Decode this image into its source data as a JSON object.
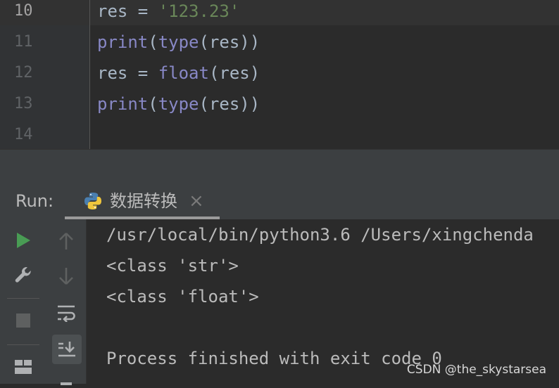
{
  "editor": {
    "lines": [
      {
        "number": "10",
        "tokens": [
          {
            "t": "res = ",
            "c": "plain"
          },
          {
            "t": "'123.23'",
            "c": "str"
          }
        ]
      },
      {
        "number": "11",
        "tokens": [
          {
            "t": "print",
            "c": "builtin"
          },
          {
            "t": "(",
            "c": "plain"
          },
          {
            "t": "type",
            "c": "builtin"
          },
          {
            "t": "(res))",
            "c": "plain"
          }
        ]
      },
      {
        "number": "12",
        "tokens": [
          {
            "t": "res = ",
            "c": "plain"
          },
          {
            "t": "float",
            "c": "builtin"
          },
          {
            "t": "(res)",
            "c": "plain"
          }
        ]
      },
      {
        "number": "13",
        "tokens": [
          {
            "t": "print",
            "c": "builtin"
          },
          {
            "t": "(",
            "c": "plain"
          },
          {
            "t": "type",
            "c": "builtin"
          },
          {
            "t": "(res))",
            "c": "plain"
          }
        ]
      },
      {
        "number": "14",
        "tokens": []
      }
    ]
  },
  "run": {
    "label": "Run:",
    "tab_title": "数据转换",
    "tab_close": "×",
    "toolbar_icons": [
      "run-icon",
      "wrench-icon",
      "stop-icon",
      "layout-icon",
      "up-arrow-icon",
      "down-arrow-icon",
      "soft-wrap-icon",
      "scroll-to-end-icon",
      "print-icon"
    ]
  },
  "console": {
    "lines": [
      "/usr/local/bin/python3.6 /Users/xingchenda",
      "<class 'str'>",
      "<class 'float'>",
      "",
      "Process finished with exit code 0"
    ]
  },
  "watermark": "CSDN @the_skystarsea",
  "colors": {
    "keyword_builtin": "#8888c6",
    "string": "#6a8759",
    "plain": "#a9b7c6",
    "run_green": "#499c54"
  }
}
